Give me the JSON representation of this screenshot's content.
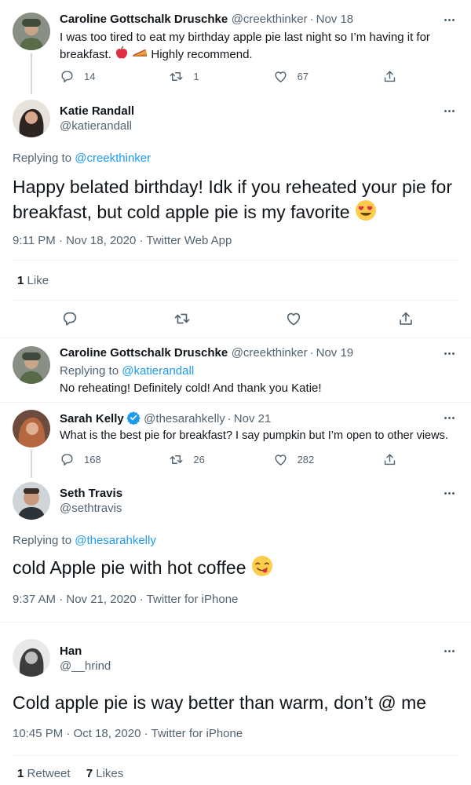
{
  "tweets": [
    {
      "name": "Caroline Gottschalk Druschke",
      "handle": "@creekthinker",
      "date": "Nov 18",
      "text_line1": "I was too tired to eat my birthday apple pie last night so I’m having it for",
      "text_line2_a": "breakfast.",
      "text_line2_b": "Highly recommend.",
      "emoji1": "apple",
      "emoji2": "pie-slice",
      "replies": "14",
      "retweets": "1",
      "likes": "67"
    },
    {
      "name": "Katie Randall",
      "handle": "@katierandall",
      "replying_label": "Replying to",
      "replying_to": "@creekthinker",
      "text_line1": "Happy belated birthday! Idk if you reheated your pie for",
      "text_line2": "breakfast, but cold apple pie is my favorite",
      "emoji": "heart-eyes",
      "meta": "9:11 PM · Nov 18, 2020 · Twitter Web App",
      "like_count": "1",
      "like_label": "Like"
    },
    {
      "name": "Caroline Gottschalk Druschke",
      "handle": "@creekthinker",
      "date": "Nov 19",
      "replying_label": "Replying to",
      "replying_to": "@katierandall",
      "text": "No reheating! Definitely cold! And thank you Katie!"
    },
    {
      "name": "Sarah Kelly",
      "handle": "@thesarahkelly",
      "date": "Nov 21",
      "verified": true,
      "text": "What is the best pie for breakfast? I say pumpkin but I’m open to other views.",
      "replies": "168",
      "retweets": "26",
      "likes": "282"
    },
    {
      "name": "Seth Travis",
      "handle": "@sethtravis",
      "replying_label": "Replying to",
      "replying_to": "@thesarahkelly",
      "text": "cold Apple pie with hot coffee",
      "emoji": "yum-face",
      "meta": "9:37 AM · Nov 21, 2020 · Twitter for iPhone"
    },
    {
      "name": "Han",
      "handle": "@__hrind",
      "text": "Cold apple pie is way better than warm, don’t @ me",
      "meta": "10:45 PM · Oct 18, 2020 · Twitter for iPhone",
      "retweet_count": "1",
      "retweet_label": "Retweet",
      "like_count": "7",
      "like_label": "Likes"
    }
  ],
  "colors": {
    "link": "#1d9bf0",
    "muted": "#536471",
    "text": "#0f1419",
    "divider": "#eff3f4",
    "verified": "#1d9bf0"
  },
  "icons": [
    "reply-icon",
    "retweet-icon",
    "like-icon",
    "share-icon",
    "more-icon",
    "verified-badge-icon"
  ]
}
